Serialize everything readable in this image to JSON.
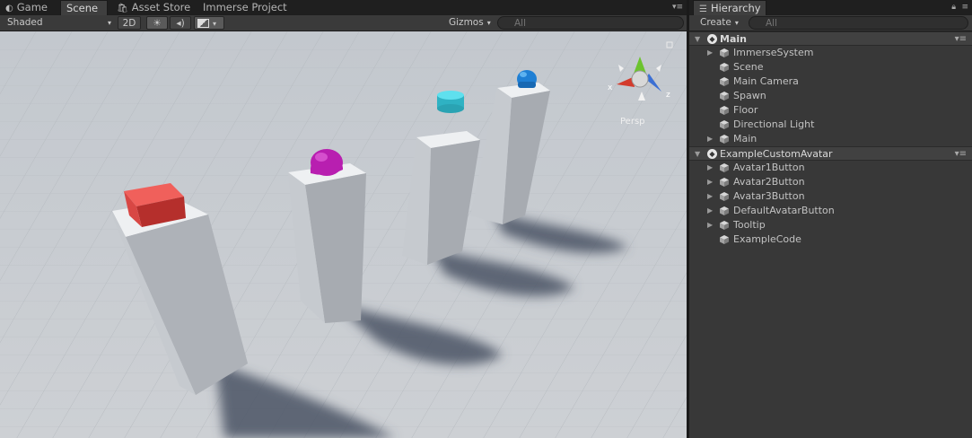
{
  "scene_tabs": {
    "game": "Game",
    "scene": "Scene",
    "asset_store": "Asset Store",
    "immerse_project": "Immerse Project"
  },
  "scene_toolbar": {
    "shading_mode": "Shaded",
    "mode_2d": "2D",
    "gizmos": "Gizmos",
    "search_placeholder": "All"
  },
  "gizmo": {
    "projection": "Persp",
    "axis_x": "x",
    "axis_z": "z"
  },
  "hierarchy": {
    "tab": "Hierarchy",
    "create": "Create",
    "search_placeholder": "All",
    "items": [
      {
        "label": "Main",
        "type": "scene",
        "depth": 0,
        "expanded": true
      },
      {
        "label": "ImmerseSystem",
        "type": "object",
        "depth": 1,
        "has_children": true
      },
      {
        "label": "Scene",
        "type": "object",
        "depth": 1,
        "has_children": false
      },
      {
        "label": "Main Camera",
        "type": "object",
        "depth": 1,
        "has_children": false
      },
      {
        "label": "Spawn",
        "type": "object",
        "depth": 1,
        "has_children": false
      },
      {
        "label": "Floor",
        "type": "object",
        "depth": 1,
        "has_children": false
      },
      {
        "label": "Directional Light",
        "type": "object",
        "depth": 1,
        "has_children": false
      },
      {
        "label": "Main",
        "type": "object",
        "depth": 1,
        "has_children": true
      },
      {
        "label": "ExampleCustomAvatar",
        "type": "scene",
        "depth": 0,
        "expanded": true
      },
      {
        "label": "Avatar1Button",
        "type": "object",
        "depth": 1,
        "has_children": true
      },
      {
        "label": "Avatar2Button",
        "type": "object",
        "depth": 1,
        "has_children": true
      },
      {
        "label": "Avatar3Button",
        "type": "object",
        "depth": 1,
        "has_children": true
      },
      {
        "label": "DefaultAvatarButton",
        "type": "object",
        "depth": 1,
        "has_children": true
      },
      {
        "label": "Tooltip",
        "type": "object",
        "depth": 1,
        "has_children": true
      },
      {
        "label": "ExampleCode",
        "type": "object",
        "depth": 1,
        "has_children": false
      }
    ]
  },
  "colors": {
    "panel_bg": "#383838",
    "tab_bg": "#1f1f1f",
    "sky": "#c6cbd1",
    "ground": "#c9ccd0",
    "pillar": "#c4c8cc",
    "cube_red": "#e0433f",
    "sphere_magenta": "#b81fb0",
    "cylinder_cyan": "#39c5d6",
    "avatar_blue": "#1f7fd4",
    "gizmo_x": "#d33b2c",
    "gizmo_y": "#6cc32e",
    "gizmo_z": "#3b6fd4"
  }
}
